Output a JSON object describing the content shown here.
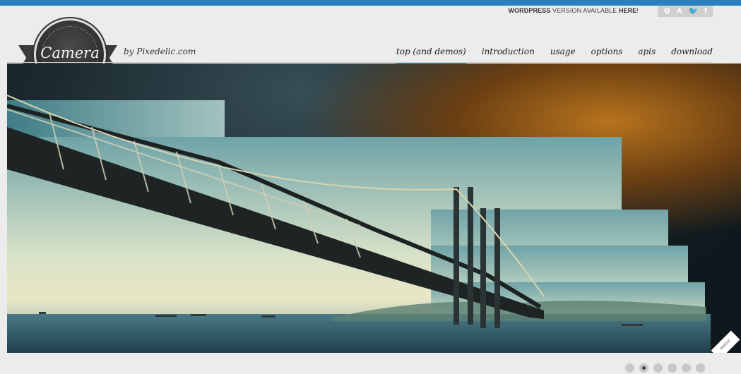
{
  "header": {
    "notice_bold": "WORDPRESS",
    "notice_mid": " VERSION AVAILABLE ",
    "notice_link": "HERE",
    "notice_end": "!",
    "social_icons": [
      "dribbble-icon",
      "forrst-icon",
      "twitter-icon",
      "facebook-icon"
    ],
    "social_glyphs": [
      "⚙",
      "A",
      "🐦",
      "f"
    ]
  },
  "logo": {
    "text": "Camera",
    "byline": "by Pixedelic.com"
  },
  "nav": {
    "items": [
      {
        "label": "top (and demos)",
        "active": true
      },
      {
        "label": "introduction",
        "active": false
      },
      {
        "label": "usage",
        "active": false
      },
      {
        "label": "options",
        "active": false
      },
      {
        "label": "apis",
        "active": false
      },
      {
        "label": "download",
        "active": false
      }
    ]
  },
  "slider": {
    "pager_count": 6,
    "active_index": 1,
    "resize_label": "resize"
  },
  "colors": {
    "accent": "#2ab4b8",
    "page_bg": "#ececec",
    "outer": "#2a7fbf"
  }
}
